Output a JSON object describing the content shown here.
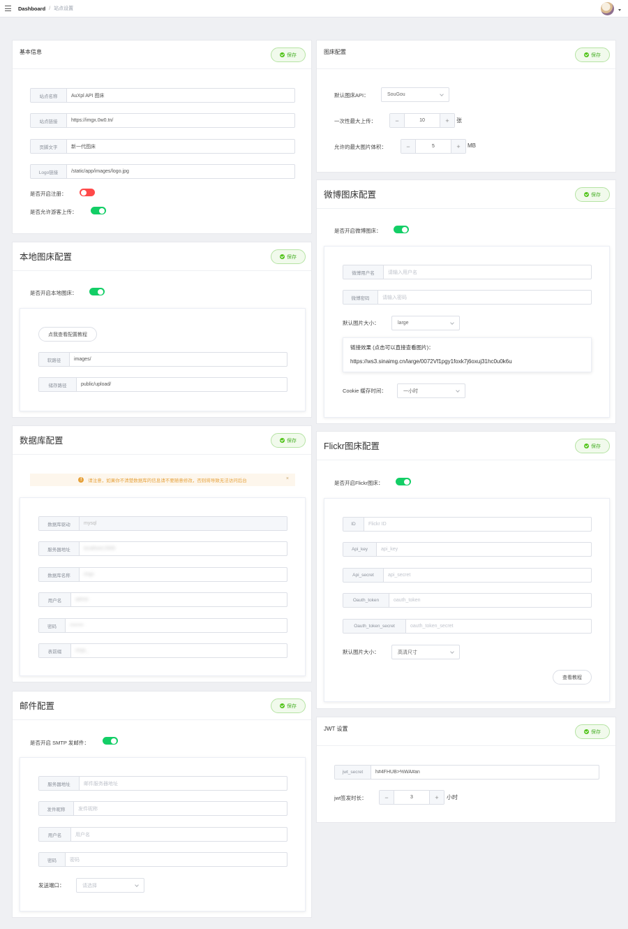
{
  "header": {
    "breadcrumb_home": "Dashboard",
    "breadcrumb_sep": "/",
    "breadcrumb_current": "站点设置"
  },
  "save_label": "保存",
  "basic": {
    "title": "基本信息",
    "fields": [
      {
        "label": "站点名称",
        "value": "AuXpl API 图床"
      },
      {
        "label": "站点链接",
        "value": "https://imgx.0w0.tn/"
      },
      {
        "label": "页脚文字",
        "value": "新一代图床"
      },
      {
        "label": "Logo链接",
        "value": "/static/app/images/logo.jpg"
      }
    ],
    "register_label": "是否开启注册：",
    "register_on": false,
    "guest_upload_label": "是否允许游客上传：",
    "guest_upload_on": true
  },
  "local": {
    "title": "本地图床配置",
    "enable_label": "是否开启本地图床：",
    "enable_on": true,
    "tutorial_button": "点我查看配置教程",
    "fields": [
      {
        "label": "软路径",
        "value": "images/"
      },
      {
        "label": "储存路径",
        "value": "public/upload/"
      }
    ]
  },
  "database": {
    "title": "数据库配置",
    "alert": "请注意，如果你不清楚数据库的信息请不要随意修改，否则将导致无法访问后台",
    "alert_close": "×",
    "alert_icon": "!",
    "fields": [
      {
        "label": "数据库驱动",
        "value": "mysql",
        "disabled": true
      },
      {
        "label": "服务器地址",
        "value": "localhost:3306"
      },
      {
        "label": "数据库名称",
        "value": "imgx"
      },
      {
        "label": "用户名",
        "value": "admin"
      },
      {
        "label": "密码",
        "value": "••••••••"
      },
      {
        "label": "表前缀",
        "value": "imgx_"
      }
    ]
  },
  "mail": {
    "title": "邮件配置",
    "enable_label": "是否开启 SMTP 发邮件：",
    "enable_on": true,
    "fields": [
      {
        "label": "服务器地址",
        "placeholder": "邮件服务器地址"
      },
      {
        "label": "发件昵称",
        "placeholder": "发件昵称"
      },
      {
        "label": "用户名",
        "placeholder": "用户名"
      },
      {
        "label": "密码",
        "placeholder": "密码"
      }
    ],
    "port_label": "发送端口：",
    "port_placeholder": "请选择"
  },
  "imgbed": {
    "title": "图床配置",
    "api_label": "默认图床API：",
    "api_value": "SouGou",
    "max_upload_label": "一次性最大上传：",
    "max_upload_value": "10",
    "max_upload_unit": "张",
    "max_size_label": "允许的最大图片体积：",
    "max_size_value": "5",
    "max_size_unit": "MB",
    "minus": "−",
    "plus": "+"
  },
  "weibo": {
    "title": "微博图床配置",
    "enable_label": "是否开启微博图床：",
    "enable_on": true,
    "fields": [
      {
        "label": "微博用户名",
        "placeholder": "请输入用户名"
      },
      {
        "label": "微博密码",
        "placeholder": "请输入密码"
      }
    ],
    "size_label": "默认图片大小：",
    "size_value": "large",
    "link_title": "链接效果 (点击可以直接查看图片)：",
    "link_url": "https://ws3.sinaimg.cn/large/0072Vf1pgy1foxk7j6oxuj31hc0u0k6u",
    "cookie_label": "Cookie 缓存时间：",
    "cookie_value": "一小时"
  },
  "flickr": {
    "title": "Flickr图床配置",
    "enable_label": "是否开启Flickr图床：",
    "enable_on": true,
    "fields": [
      {
        "label": "ID",
        "placeholder": "Flickr ID"
      },
      {
        "label": "Api_key",
        "placeholder": "api_key"
      },
      {
        "label": "Api_secret",
        "placeholder": "api_secret"
      },
      {
        "label": "Oauth_token",
        "placeholder": "oauth_token"
      },
      {
        "label": "Oauth_token_secret",
        "placeholder": "oauth_token_secret"
      }
    ],
    "size_label": "默认图片大小：",
    "size_value": "高清尺寸",
    "tutorial_button": "查看教程"
  },
  "jwt": {
    "title": "JWT 设置",
    "secret_label": "jwt_secret",
    "secret_value": "h#4FHUB>%WA#an",
    "duration_label": "jwt签发时长：",
    "duration_value": "3",
    "duration_unit": "小时"
  },
  "colors": {
    "accent_green": "#13ce66",
    "switch_off": "#ff4949",
    "save_green": "#52c41a",
    "warning": "#e6a23c"
  }
}
